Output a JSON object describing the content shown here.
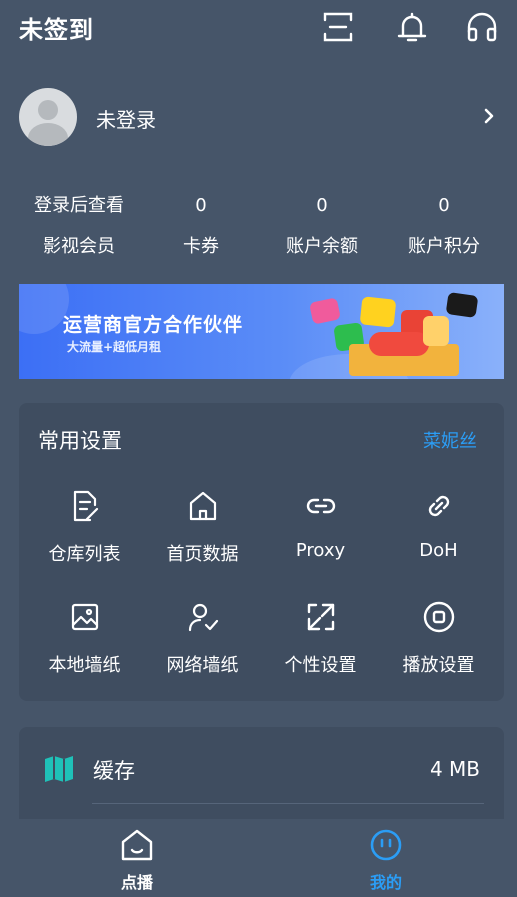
{
  "header": {
    "title": "未签到",
    "icons": [
      "scan-icon",
      "bell-icon",
      "headset-icon"
    ]
  },
  "profile": {
    "name": "未登录"
  },
  "stats": [
    {
      "value": "登录后查看",
      "label": "影视会员"
    },
    {
      "value": "0",
      "label": "卡券"
    },
    {
      "value": "0",
      "label": "账户余额"
    },
    {
      "value": "0",
      "label": "账户积分"
    }
  ],
  "banner": {
    "title": "运营商官方合作伙伴",
    "subtitle": "大流量+超低月租"
  },
  "settings": {
    "title": "常用设置",
    "link": "菜妮丝",
    "items": [
      {
        "label": "仓库列表",
        "icon": "document-edit-icon"
      },
      {
        "label": "首页数据",
        "icon": "home-icon"
      },
      {
        "label": "Proxy",
        "icon": "link-icon"
      },
      {
        "label": "DoH",
        "icon": "chain-icon"
      },
      {
        "label": "本地墙纸",
        "icon": "image-icon"
      },
      {
        "label": "网络墙纸",
        "icon": "user-check-icon"
      },
      {
        "label": "个性设置",
        "icon": "expand-icon"
      },
      {
        "label": "播放设置",
        "icon": "stop-circle-icon"
      }
    ]
  },
  "cache": {
    "label": "缓存",
    "value": "4 MB",
    "icon": "map-icon"
  },
  "nav": [
    {
      "label": "点播",
      "icon": "home-face-icon"
    },
    {
      "label": "我的",
      "icon": "face-icon"
    }
  ],
  "colors": {
    "background": "#465569",
    "card": "#3f4d60",
    "accent": "#2b9df5",
    "cache_icon": "#1fc1b8"
  }
}
